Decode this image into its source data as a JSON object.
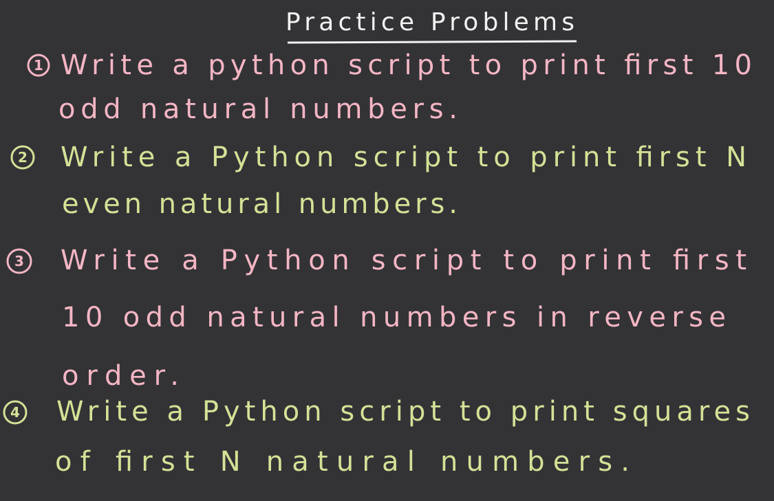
{
  "title": "Practice Problems",
  "colors": {
    "background": "#333336",
    "title": "#f2f2f2",
    "pink": "#f5b6c4",
    "green": "#d3e296"
  },
  "problems": [
    {
      "number": "1",
      "lines": [
        "Write a python script to print first 10",
        "odd natural numbers."
      ]
    },
    {
      "number": "2",
      "lines": [
        "Write a Python script to print first N",
        "even natural numbers."
      ]
    },
    {
      "number": "3",
      "lines": [
        "Write a Python script to print first",
        "10 odd natural numbers in reverse",
        "order."
      ]
    },
    {
      "number": "4",
      "lines": [
        "Write a Python script to print squares",
        "of first N natural numbers."
      ]
    }
  ]
}
